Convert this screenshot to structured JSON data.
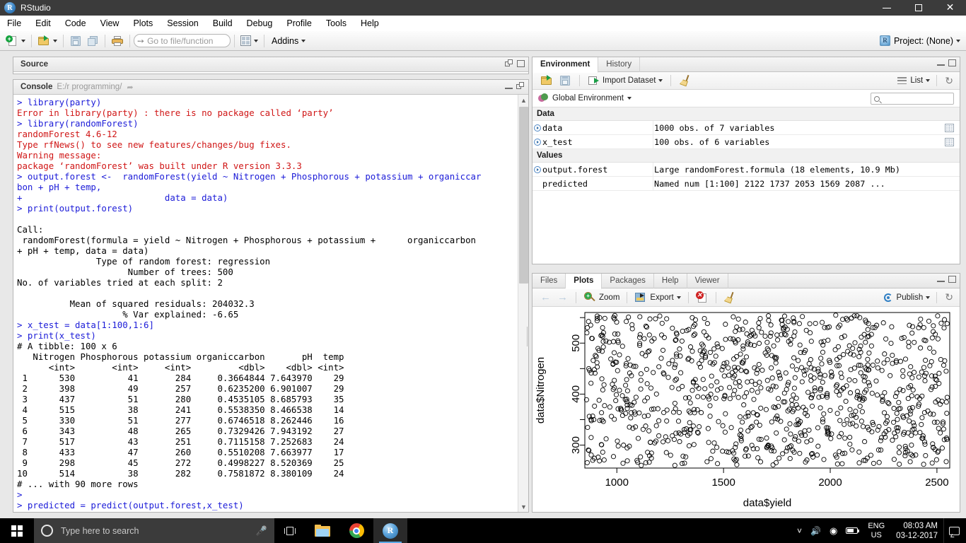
{
  "window": {
    "title": "RStudio",
    "icon": "rstudio-icon"
  },
  "menubar": {
    "items": [
      "File",
      "Edit",
      "Code",
      "View",
      "Plots",
      "Session",
      "Build",
      "Debug",
      "Profile",
      "Tools",
      "Help"
    ]
  },
  "toolbar": {
    "new_file": "new-file-icon",
    "open_file": "open-folder-icon",
    "save": "save-icon",
    "save_all": "save-all-icon",
    "print": "print-icon",
    "goto_placeholder": "Go to file/function",
    "panes_icon": "panes-grid-icon",
    "addins_label": "Addins",
    "project_label": "Project: (None)"
  },
  "source_pane": {
    "title": "Source"
  },
  "console_pane": {
    "title": "Console",
    "path": "E:/r programming/",
    "lines": [
      {
        "type": "cmd",
        "text": "> library(party)"
      },
      {
        "type": "err",
        "text": "Error in library(party) : there is no package called ‘party’"
      },
      {
        "type": "cmd",
        "text": "> library(randomForest)"
      },
      {
        "type": "err",
        "text": "randomForest 4.6-12"
      },
      {
        "type": "err",
        "text": "Type rfNews() to see new features/changes/bug fixes."
      },
      {
        "type": "err",
        "text": "Warning message:"
      },
      {
        "type": "err",
        "text": "package ‘randomForest’ was built under R version 3.3.3"
      },
      {
        "type": "cmd",
        "text": "> output.forest <-  randomForest(yield ~ Nitrogen + Phosphorous + potassium + organiccar"
      },
      {
        "type": "cmd",
        "text": "bon + pH + temp,"
      },
      {
        "type": "cmd",
        "text": "+                           data = data)"
      },
      {
        "type": "cmd",
        "text": "> print(output.forest)"
      },
      {
        "type": "out",
        "text": ""
      },
      {
        "type": "out",
        "text": "Call:"
      },
      {
        "type": "out",
        "text": " randomForest(formula = yield ~ Nitrogen + Phosphorous + potassium +      organiccarbon"
      },
      {
        "type": "out",
        "text": "+ pH + temp, data = data)"
      },
      {
        "type": "out",
        "text": "               Type of random forest: regression"
      },
      {
        "type": "out",
        "text": "                     Number of trees: 500"
      },
      {
        "type": "out",
        "text": "No. of variables tried at each split: 2"
      },
      {
        "type": "out",
        "text": ""
      },
      {
        "type": "out",
        "text": "          Mean of squared residuals: 204032.3"
      },
      {
        "type": "out",
        "text": "                    % Var explained: -6.65"
      },
      {
        "type": "cmd",
        "text": "> x_test = data[1:100,1:6]"
      },
      {
        "type": "cmd",
        "text": "> print(x_test)"
      },
      {
        "type": "out",
        "text": "# A tibble: 100 x 6"
      },
      {
        "type": "out",
        "text": "   Nitrogen Phosphorous potassium organiccarbon       pH  temp"
      },
      {
        "type": "out",
        "text": "      <int>       <int>     <int>         <dbl>    <dbl> <int>"
      },
      {
        "type": "out",
        "text": " 1      530          41       284     0.3664844 7.643970    29"
      },
      {
        "type": "out",
        "text": " 2      398          49       257     0.6235200 6.901007    29"
      },
      {
        "type": "out",
        "text": " 3      437          51       280     0.4535105 8.685793    35"
      },
      {
        "type": "out",
        "text": " 4      515          38       241     0.5538350 8.466538    14"
      },
      {
        "type": "out",
        "text": " 5      330          51       277     0.6746518 8.262446    16"
      },
      {
        "type": "out",
        "text": " 6      343          48       265     0.7329426 7.943192    27"
      },
      {
        "type": "out",
        "text": " 7      517          43       251     0.7115158 7.252683    24"
      },
      {
        "type": "out",
        "text": " 8      433          47       260     0.5510208 7.663977    17"
      },
      {
        "type": "out",
        "text": " 9      298          45       272     0.4998227 8.520369    25"
      },
      {
        "type": "out",
        "text": "10      514          38       282     0.7581872 8.380109    24"
      },
      {
        "type": "out",
        "text": "# ... with 90 more rows"
      },
      {
        "type": "cmd",
        "text": ">"
      },
      {
        "type": "cmd",
        "text": "> predicted = predict(output.forest,x_test)"
      }
    ]
  },
  "environment_pane": {
    "tabs": [
      {
        "label": "Environment",
        "active": true
      },
      {
        "label": "History",
        "active": false
      }
    ],
    "toolbar": {
      "open_icon": "open-folder-icon",
      "save_icon": "save-icon",
      "import_label": "Import Dataset",
      "broom_icon": "broom-icon",
      "view_label": "List",
      "refresh_icon": "refresh-icon"
    },
    "scope_label": "Global Environment",
    "search_placeholder": "",
    "sections": [
      {
        "label": "Data",
        "rows": [
          {
            "name": "data",
            "value": "1000 obs. of 7 variables",
            "expandable": true,
            "grid": true
          },
          {
            "name": "x_test",
            "value": "100 obs. of 6 variables",
            "expandable": true,
            "grid": true
          }
        ]
      },
      {
        "label": "Values",
        "rows": [
          {
            "name": "output.forest",
            "value": "Large randomForest.formula (18 elements, 10.9 Mb)",
            "expandable": true,
            "grid": false
          },
          {
            "name": "predicted",
            "value": "Named num [1:100] 2122 1737 2053 1569 2087 ...",
            "expandable": false,
            "grid": false
          }
        ]
      }
    ]
  },
  "plots_pane": {
    "tabs": [
      {
        "label": "Files",
        "active": false
      },
      {
        "label": "Plots",
        "active": true
      },
      {
        "label": "Packages",
        "active": false
      },
      {
        "label": "Help",
        "active": false
      },
      {
        "label": "Viewer",
        "active": false
      }
    ],
    "toolbar": {
      "back_icon": "arrow-left-icon",
      "forward_icon": "arrow-right-icon",
      "zoom_label": "Zoom",
      "export_label": "Export",
      "remove_icon": "remove-plot-icon",
      "clear_icon": "broom-icon",
      "publish_label": "Publish",
      "refresh_icon": "refresh-icon"
    }
  },
  "chart_data": {
    "type": "scatter",
    "title": "",
    "xlabel": "data$yield",
    "ylabel": "data$Nitrogen",
    "xlim": [
      850,
      2560
    ],
    "ylim": [
      255,
      560
    ],
    "xticks": [
      1000,
      1500,
      2000,
      2500
    ],
    "yticks": [
      300,
      400,
      500
    ],
    "y_minor_ticks": [
      350,
      450,
      550
    ],
    "n_points": 1000,
    "marker": "open-circle",
    "marker_color": "#000000",
    "grid": false,
    "legend": null,
    "description": "Uniformly scattered open circles filling the plot region; no visible correlation between data$yield and data$Nitrogen."
  },
  "taskbar": {
    "start_icon": "windows-start-icon",
    "search_placeholder": "Type here to search",
    "mic_icon": "microphone-icon",
    "taskview_icon": "task-view-icon",
    "apps": [
      {
        "name": "file-explorer-icon",
        "active": false
      },
      {
        "name": "google-chrome-icon",
        "active": false
      },
      {
        "name": "rstudio-icon",
        "active": true
      }
    ],
    "tray": {
      "chevron": "show-hidden-icons-icon",
      "volume": "volume-icon",
      "network": "wifi-icon",
      "battery": "battery-icon",
      "language_line1": "ENG",
      "language_line2": "US",
      "time": "08:03 AM",
      "date": "03-12-2017",
      "action_center": "action-center-icon"
    }
  }
}
